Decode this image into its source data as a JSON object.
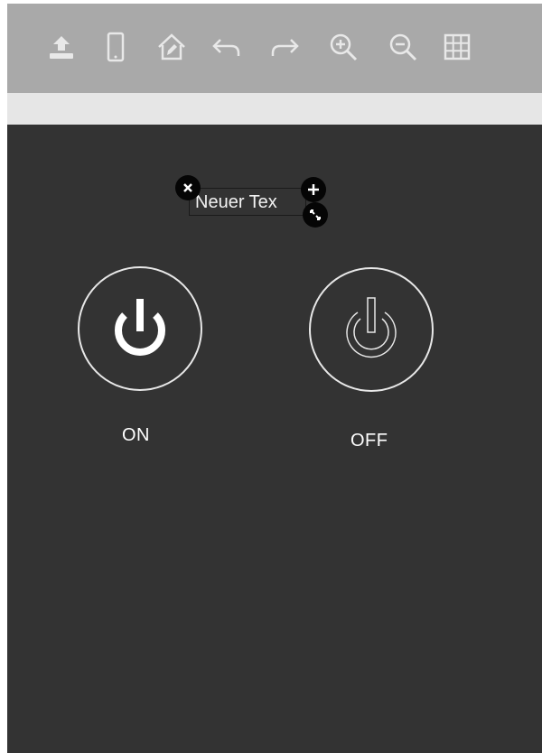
{
  "toolbar": {
    "icons": [
      "upload-icon",
      "mobile-device-icon",
      "home-edit-icon",
      "undo-icon",
      "redo-icon",
      "zoom-in-icon",
      "zoom-out-icon",
      "grid-icon"
    ],
    "icon_color": "#e8e8e8"
  },
  "canvas": {
    "background": "#333333",
    "text_widget": {
      "text": "Neuer Tex",
      "handles": [
        "close-icon",
        "plus-icon",
        "resize-icon"
      ]
    },
    "buttons": [
      {
        "label": "ON",
        "icon": "power-icon",
        "state": "on"
      },
      {
        "label": "OFF",
        "icon": "power-outline-icon",
        "state": "off"
      }
    ]
  }
}
